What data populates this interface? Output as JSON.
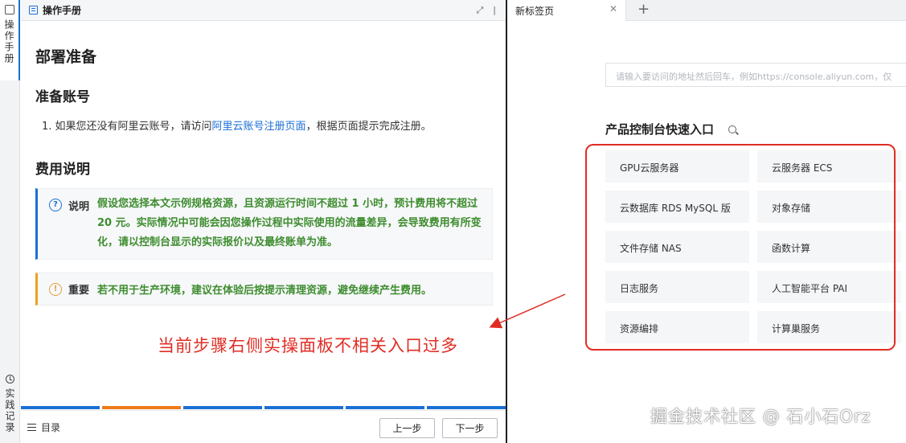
{
  "rail": {
    "tab_label": "操作手册",
    "bottom_label": "实践记录"
  },
  "manual": {
    "title": "操作手册",
    "h1": "部署准备",
    "h2_account": "准备账号",
    "step1_prefix": "1. 如果您还没有阿里云账号，请访问",
    "step1_link": "阿里云账号注册页面",
    "step1_suffix": "，根据页面提示完成注册。",
    "h2_cost": "费用说明",
    "note_label": "说明",
    "note_text": "假设您选择本文示例规格资源，且资源运行时间不超过 1 小时，预计费用将不超过 20 元。实际情况中可能会因您操作过程中实际使用的流量差异，会导致费用有所变化，请以控制台显示的实际报价以及最终账单为准。",
    "warn_label": "重要",
    "warn_text": "若不用于生产环境，建议在体验后按提示清理资源，避免继续产生费用。",
    "toc_label": "目录",
    "prev_label": "上一步",
    "next_label": "下一步",
    "progress_colors": [
      "#1a6fd6",
      "#ee7a1a",
      "#1a6fd6",
      "#1a6fd6",
      "#1a6fd6",
      "#1a6fd6"
    ]
  },
  "annotation": {
    "text": "当前步骤右侧实操面板不相关入口过多",
    "color": "#e02d24"
  },
  "browser": {
    "tab_title": "新标签页",
    "address_placeholder": "请输入要访问的地址然后回车，例如https://console.aliyun.com，仅",
    "section_title": "产品控制台快速入口",
    "items": [
      "GPU云服务器",
      "云服务器 ECS",
      "云数据库 RDS MySQL 版",
      "对象存储",
      "文件存储 NAS",
      "函数计算",
      "日志服务",
      "人工智能平台 PAI",
      "资源编排",
      "计算巢服务"
    ]
  },
  "watermark": "掘金技术社区 @ 石小石Orz"
}
